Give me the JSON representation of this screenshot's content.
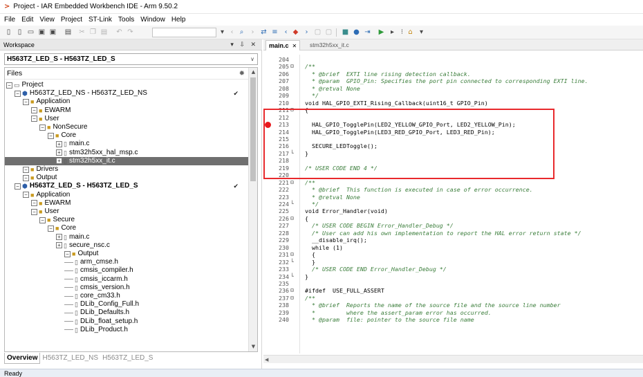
{
  "window": {
    "title": "Project - IAR Embedded Workbench IDE - Arm 9.50.2"
  },
  "menu": [
    "File",
    "Edit",
    "View",
    "Project",
    "ST-Link",
    "Tools",
    "Window",
    "Help"
  ],
  "workspace": {
    "header": "Workspace",
    "config": "H563TZ_LED_S - H563TZ_LED_S",
    "files_label": "Files",
    "tree": [
      {
        "label": "Project",
        "depth": 0,
        "icon": "root"
      },
      {
        "label": "H563TZ_LED_NS - H563TZ_LED_NS",
        "depth": 1,
        "icon": "proj",
        "checked": true
      },
      {
        "label": "Application",
        "depth": 2,
        "icon": "folder"
      },
      {
        "label": "EWARM",
        "depth": 3,
        "icon": "folder"
      },
      {
        "label": "User",
        "depth": 3,
        "icon": "folder"
      },
      {
        "label": "NonSecure",
        "depth": 4,
        "icon": "folder"
      },
      {
        "label": "Core",
        "depth": 5,
        "icon": "folder"
      },
      {
        "label": "main.c",
        "depth": 6,
        "icon": "file"
      },
      {
        "label": "stm32h5xx_hal_msp.c",
        "depth": 6,
        "icon": "file"
      },
      {
        "label": "stm32h5xx_it.c",
        "depth": 6,
        "icon": "file",
        "selected": true
      },
      {
        "label": "Drivers",
        "depth": 2,
        "icon": "folder"
      },
      {
        "label": "Output",
        "depth": 2,
        "icon": "folder"
      },
      {
        "label": "H563TZ_LED_S - H563TZ_LED_S",
        "depth": 1,
        "icon": "proj",
        "bold": true,
        "checked": true
      },
      {
        "label": "Application",
        "depth": 2,
        "icon": "folder"
      },
      {
        "label": "EWARM",
        "depth": 3,
        "icon": "folder"
      },
      {
        "label": "User",
        "depth": 3,
        "icon": "folder"
      },
      {
        "label": "Secure",
        "depth": 4,
        "icon": "folder"
      },
      {
        "label": "Core",
        "depth": 5,
        "icon": "folder"
      },
      {
        "label": "main.c",
        "depth": 6,
        "icon": "file"
      },
      {
        "label": "secure_nsc.c",
        "depth": 6,
        "icon": "file"
      },
      {
        "label": "Output",
        "depth": 7,
        "icon": "folder"
      },
      {
        "label": "arm_cmse.h",
        "depth": 7,
        "icon": "file",
        "leaf": true
      },
      {
        "label": "cmsis_compiler.h",
        "depth": 7,
        "icon": "file",
        "leaf": true
      },
      {
        "label": "cmsis_iccarm.h",
        "depth": 7,
        "icon": "file",
        "leaf": true
      },
      {
        "label": "cmsis_version.h",
        "depth": 7,
        "icon": "file",
        "leaf": true
      },
      {
        "label": "core_cm33.h",
        "depth": 7,
        "icon": "file",
        "leaf": true
      },
      {
        "label": "DLib_Config_Full.h",
        "depth": 7,
        "icon": "file",
        "leaf": true
      },
      {
        "label": "DLib_Defaults.h",
        "depth": 7,
        "icon": "file",
        "leaf": true
      },
      {
        "label": "DLib_float_setup.h",
        "depth": 7,
        "icon": "file",
        "leaf": true
      },
      {
        "label": "DLib_Product.h",
        "depth": 7,
        "icon": "file",
        "leaf": true
      }
    ],
    "tabs": {
      "overview": "Overview",
      "ns": "H563TZ_LED_NS",
      "s": "H563TZ_LED_S"
    }
  },
  "editor": {
    "tabs": [
      {
        "label": "main.c",
        "active": true
      },
      {
        "label": "stm32h5xx_it.c",
        "active": false
      }
    ],
    "lines": [
      {
        "n": "204",
        "fold": "",
        "t": "",
        "c": ""
      },
      {
        "n": "205",
        "fold": "⊟",
        "t": "/**",
        "c": "comment"
      },
      {
        "n": "206",
        "fold": "",
        "t": "  * @brief  EXTI line rising detection callback.",
        "c": "comment"
      },
      {
        "n": "207",
        "fold": "",
        "t": "  * @param  GPIO_Pin: Specifies the port pin connected to corresponding EXTI line.",
        "c": "comment"
      },
      {
        "n": "208",
        "fold": "",
        "t": "  * @retval None",
        "c": "comment"
      },
      {
        "n": "209",
        "fold": "",
        "t": "  */",
        "c": "comment"
      },
      {
        "n": "210",
        "fold": "",
        "t": "void HAL_GPIO_EXTI_Rising_Callback(uint16_t GPIO_Pin)",
        "c": "kw"
      },
      {
        "n": "211",
        "fold": "⊟",
        "t": "{",
        "c": ""
      },
      {
        "n": "212",
        "fold": "",
        "t": "",
        "c": ""
      },
      {
        "n": "213",
        "fold": "",
        "t": "  HAL_GPIO_TogglePin(LED2_YELLOW_GPIO_Port, LED2_YELLOW_Pin);",
        "c": "",
        "bp": true
      },
      {
        "n": "214",
        "fold": "",
        "t": "  HAL_GPIO_TogglePin(LED3_RED_GPIO_Port, LED3_RED_Pin);",
        "c": ""
      },
      {
        "n": "215",
        "fold": "",
        "t": "",
        "c": ""
      },
      {
        "n": "216",
        "fold": "",
        "t": "  SECURE_LEDToggle();",
        "c": ""
      },
      {
        "n": "217",
        "fold": "└",
        "t": "}",
        "c": ""
      },
      {
        "n": "218",
        "fold": "",
        "t": "",
        "c": ""
      },
      {
        "n": "219",
        "fold": "",
        "t": "/* USER CODE END 4 */",
        "c": "comment"
      },
      {
        "n": "220",
        "fold": "",
        "t": "",
        "c": ""
      },
      {
        "n": "221",
        "fold": "⊟",
        "t": "/**",
        "c": "comment"
      },
      {
        "n": "222",
        "fold": "",
        "t": "  * @brief  This function is executed in case of error occurrence.",
        "c": "comment"
      },
      {
        "n": "223",
        "fold": "",
        "t": "  * @retval None",
        "c": "comment"
      },
      {
        "n": "224",
        "fold": "└",
        "t": "  */",
        "c": "comment"
      },
      {
        "n": "225",
        "fold": "",
        "t": "void Error_Handler(void)",
        "c": "kw"
      },
      {
        "n": "226",
        "fold": "⊟",
        "t": "{",
        "c": ""
      },
      {
        "n": "227",
        "fold": "",
        "t": "  /* USER CODE BEGIN Error_Handler_Debug */",
        "c": "comment"
      },
      {
        "n": "228",
        "fold": "",
        "t": "  /* User can add his own implementation to report the HAL error return state */",
        "c": "comment"
      },
      {
        "n": "229",
        "fold": "",
        "t": "  __disable_irq();",
        "c": ""
      },
      {
        "n": "230",
        "fold": "",
        "t": "  while (1)",
        "c": "kw"
      },
      {
        "n": "231",
        "fold": "⊟",
        "t": "  {",
        "c": ""
      },
      {
        "n": "232",
        "fold": "└",
        "t": "  }",
        "c": ""
      },
      {
        "n": "233",
        "fold": "",
        "t": "  /* USER CODE END Error_Handler_Debug */",
        "c": "comment"
      },
      {
        "n": "234",
        "fold": "└",
        "t": "}",
        "c": ""
      },
      {
        "n": "235",
        "fold": "",
        "t": "",
        "c": ""
      },
      {
        "n": "236",
        "fold": "⊟",
        "t": "#ifdef  USE_FULL_ASSERT",
        "c": "kw"
      },
      {
        "n": "237",
        "fold": "⊟",
        "t": "/**",
        "c": "comment"
      },
      {
        "n": "238",
        "fold": "",
        "t": "  * @brief  Reports the name of the source file and the source line number",
        "c": "comment"
      },
      {
        "n": "239",
        "fold": "",
        "t": "  *         where the assert_param error has occurred.",
        "c": "comment"
      },
      {
        "n": "240",
        "fold": "",
        "t": "  * @param  file: pointer to the source file name",
        "c": "comment"
      }
    ]
  },
  "status": {
    "text": "Ready"
  },
  "colors": {
    "breakpoint": "#e8181c",
    "highlight_box": "#e8292c",
    "folder": "#c99a1f",
    "comment": "#3a7d3a"
  }
}
